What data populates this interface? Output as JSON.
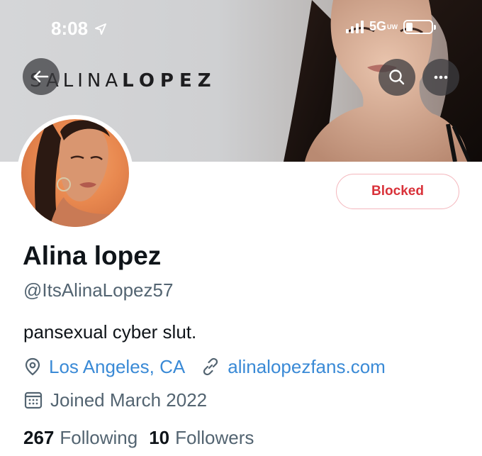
{
  "status_bar": {
    "time": "8:08",
    "network": "5G",
    "network_sub": "UW"
  },
  "banner": {
    "brand_light": "SALINA",
    "brand_bold": "LOPEZ"
  },
  "profile": {
    "display_name": "Alina lopez",
    "handle": "@ItsAlinaLopez57",
    "bio": "pansexual cyber slut.",
    "location": "Los Angeles, CA",
    "website": "alinalopezfans.com",
    "joined": "Joined March 2022",
    "following_count": "267",
    "following_label": "Following",
    "followers_count": "10",
    "followers_label": "Followers"
  },
  "actions": {
    "blocked_label": "Blocked"
  },
  "icons": {
    "back": "back-arrow-icon",
    "search": "search-icon",
    "more": "more-icon",
    "location": "location-pin-icon",
    "link": "link-icon",
    "calendar": "calendar-icon"
  },
  "colors": {
    "link": "#3a8ad6",
    "muted": "#536471",
    "blocked": "#d9323a"
  }
}
